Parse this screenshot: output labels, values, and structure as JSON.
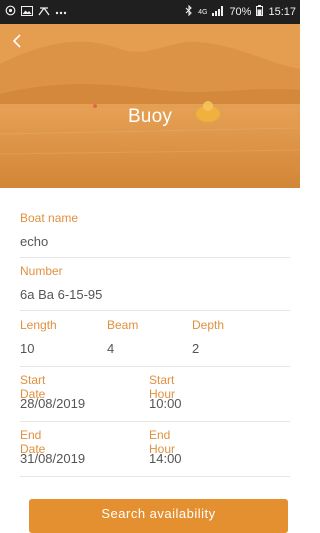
{
  "status_bar": {
    "left_icons": [
      "notification-icon",
      "image-icon",
      "tools-icon",
      "more-icon"
    ],
    "bluetooth_icon": "bluetooth-icon",
    "network_text": "4G",
    "signal_icon": "signal-icon",
    "battery": "70%",
    "time": "15:17"
  },
  "header": {
    "back_icon": "back-icon",
    "title": "Buoy"
  },
  "form": {
    "boat_name": {
      "label": "Boat name",
      "value": "echo"
    },
    "number": {
      "label": "Number",
      "value": "6a Ba 6-15-95"
    },
    "length": {
      "label": "Length",
      "value": "10"
    },
    "beam": {
      "label": "Beam",
      "value": "4"
    },
    "depth": {
      "label": "Depth",
      "value": "2"
    },
    "start_date": {
      "label": "Start Date",
      "value": "28/08/2019"
    },
    "start_hour": {
      "label": "Start Hour",
      "value": "10:00"
    },
    "end_date": {
      "label": "End Date",
      "value": "31/08/2019"
    },
    "end_hour": {
      "label": "End Hour",
      "value": "14:00"
    }
  },
  "actions": {
    "search_label": "Search availability"
  },
  "colors": {
    "accent": "#e48f30",
    "label": "#e0913f",
    "status_bar": "#1f1f1f"
  }
}
